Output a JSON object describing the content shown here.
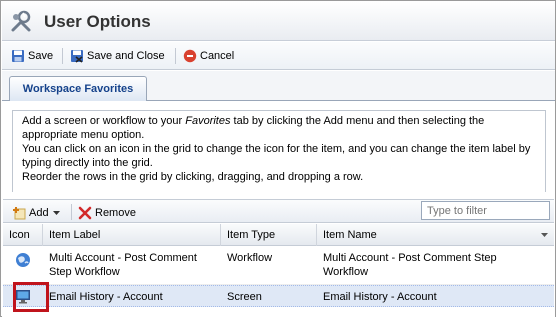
{
  "window": {
    "title": "User Options",
    "title_icon": "wrench-icon"
  },
  "toolbar": {
    "save_label": "Save",
    "save_close_label": "Save and Close",
    "cancel_label": "Cancel"
  },
  "tabs": [
    {
      "label": "Workspace Favorites",
      "active": true
    }
  ],
  "instructions": {
    "line1_pre": "Add a screen or workflow to your ",
    "line1_em": "Favorites",
    "line1_post": " tab by clicking the Add menu and then selecting the appropriate menu option.",
    "line2": "You can click on an icon in the grid to change the icon for the item, and you can change the item label by typing directly into the grid.",
    "line3": "Reorder the rows in the grid by clicking, dragging, and dropping a row."
  },
  "grid_toolbar": {
    "add_label": "Add",
    "remove_label": "Remove",
    "filter_placeholder": "Type to filter"
  },
  "grid": {
    "columns": [
      "Icon",
      "Item Label",
      "Item Type",
      "Item Name"
    ],
    "rows": [
      {
        "icon": "globe-icon",
        "label": "Multi Account - Post Comment Step Workflow",
        "type": "Workflow",
        "name": "Multi Account - Post Comment Step Workflow",
        "selected": false
      },
      {
        "icon": "monitor-icon",
        "label": "Email History - Account",
        "type": "Screen",
        "name": "Email History - Account",
        "selected": true
      }
    ]
  },
  "colors": {
    "tab_text": "#15428b",
    "selected_row": "#dfe8f6",
    "highlight_border": "#c0141c",
    "cancel_icon": "#d9412f"
  }
}
